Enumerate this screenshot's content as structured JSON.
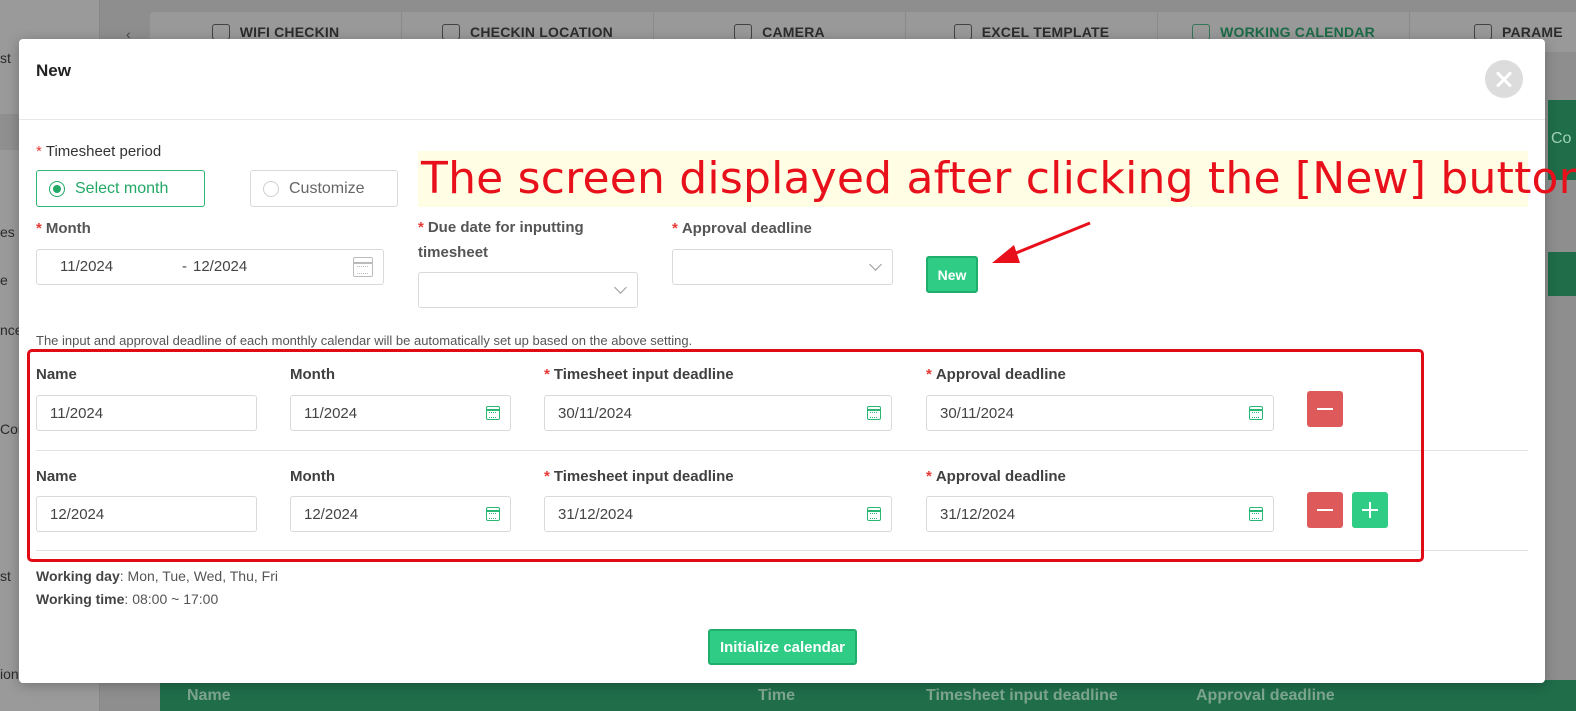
{
  "background": {
    "tabs": [
      "WIFI CHECKIN",
      "CHECKIN LOCATION",
      "CAMERA",
      "EXCEL TEMPLATE",
      "WORKING CALENDAR",
      "PARAME"
    ],
    "active_tab": "WORKING CALENDAR",
    "sidebar_fragments": [
      "st",
      "es",
      "e",
      "nce",
      "Con",
      "st",
      "ion"
    ],
    "right_fragment": "Co",
    "table_headers": [
      "Name",
      "Time",
      "Timesheet input deadline",
      "Approval deadline"
    ]
  },
  "modal": {
    "title": "New",
    "timesheet_period": {
      "label": "Timesheet period",
      "options": [
        "Select month",
        "Customize"
      ],
      "selected": "Select month"
    },
    "month": {
      "label": "Month",
      "from": "11/2024",
      "separator": "-",
      "to": "12/2024"
    },
    "due_date": {
      "label_line1": "Due date for inputting",
      "label_line2": "timesheet",
      "value": ""
    },
    "approval": {
      "label": "Approval deadline",
      "value": ""
    },
    "new_button": "New",
    "hint": "The input and approval deadline of each monthly calendar will be automatically set up based on the above setting.",
    "columns": {
      "name": "Name",
      "month": "Month",
      "input_deadline": "Timesheet input deadline",
      "approval_deadline": "Approval deadline"
    },
    "rows": [
      {
        "name": "11/2024",
        "month": "11/2024",
        "input_deadline": "30/11/2024",
        "approval_deadline": "30/11/2024"
      },
      {
        "name": "12/2024",
        "month": "12/2024",
        "input_deadline": "31/12/2024",
        "approval_deadline": "31/12/2024"
      }
    ],
    "working_day_label": "Working day",
    "working_day_value": ": Mon, Tue, Wed, Thu, Fri",
    "working_time_label": "Working time",
    "working_time_value": ": 08:00 ~ 17:00",
    "initialize_button": "Initialize calendar"
  },
  "annotation": {
    "text": "The screen displayed after clicking the [New] button",
    "color": "#e8101b"
  },
  "colors": {
    "accent": "#2ecc85",
    "danger": "#de5a5a",
    "required": "#e53935"
  }
}
